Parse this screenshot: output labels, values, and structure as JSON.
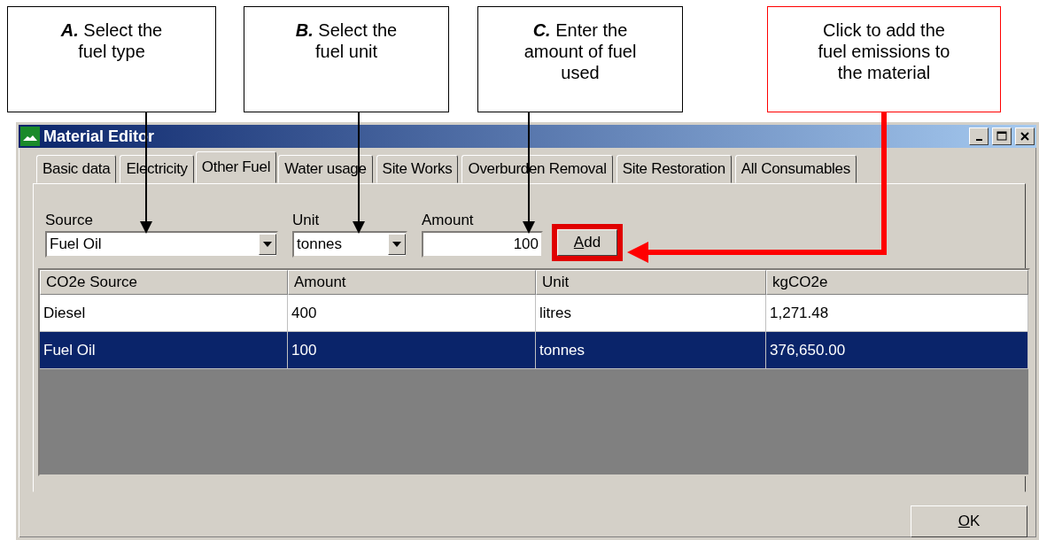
{
  "callouts": [
    {
      "kind": "step",
      "letter": "A.",
      "text": "Select the fuel type"
    },
    {
      "kind": "step",
      "letter": "B.",
      "text": "Select the fuel unit"
    },
    {
      "kind": "step",
      "letter": "C.",
      "text": "Enter the amount of fuel used"
    },
    {
      "kind": "action",
      "text": "Click to add the fuel emissions to the material"
    }
  ],
  "window": {
    "title": "Material Editor",
    "tabs": [
      {
        "label": "Basic data",
        "selected": false
      },
      {
        "label": "Electricity",
        "selected": false
      },
      {
        "label": "Other Fuel",
        "selected": true
      },
      {
        "label": "Water usage",
        "selected": false
      },
      {
        "label": "Site Works",
        "selected": false
      },
      {
        "label": "Overburden Removal",
        "selected": false
      },
      {
        "label": "Site Restoration",
        "selected": false
      },
      {
        "label": "All Consumables",
        "selected": false
      }
    ],
    "source": {
      "label": "Source",
      "value": "Fuel Oil"
    },
    "unit": {
      "label": "Unit",
      "value": "tonnes"
    },
    "amount": {
      "label": "Amount",
      "value": "100"
    },
    "add_button": "Add",
    "table": {
      "columns": [
        "CO2e Source",
        "Amount",
        "Unit",
        "kgCO2e"
      ],
      "rows": [
        {
          "selected": false,
          "cells": [
            "Diesel",
            "400",
            "litres",
            "1,271.48"
          ]
        },
        {
          "selected": true,
          "cells": [
            "Fuel Oil",
            "100",
            "tonnes",
            "376,650.00"
          ]
        }
      ]
    },
    "ok_button": "OK"
  }
}
